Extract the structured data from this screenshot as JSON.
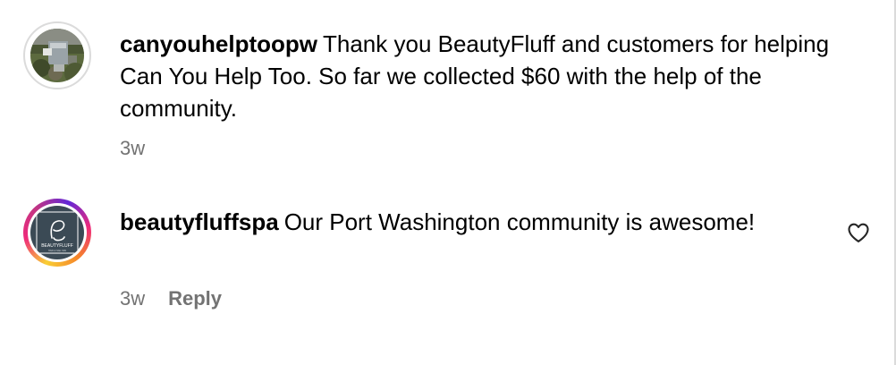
{
  "comments": [
    {
      "username": "canyouhelptoopw",
      "text": "Thank you BeautyFluff and customers for helping Can You Help Too. So far we collected $60 with the help of the community.",
      "time": "3w",
      "avatar_icon": "photo-avatar",
      "has_story_ring": false
    },
    {
      "username": "beautyfluffspa",
      "text": "Our Port Washington community is awesome!",
      "time": "3w",
      "reply_label": "Reply",
      "avatar_icon": "beautyfluff-logo",
      "avatar_brand_text": "BEAUTYFLUFF",
      "avatar_sub_text": "HAIR & NAIL SPA",
      "has_story_ring": true,
      "like_icon": "heart-outline-icon"
    }
  ],
  "colors": {
    "text": "#000000",
    "meta": "#737373",
    "divider": "#dbdbdb",
    "logo_background": "#3b4a55"
  }
}
